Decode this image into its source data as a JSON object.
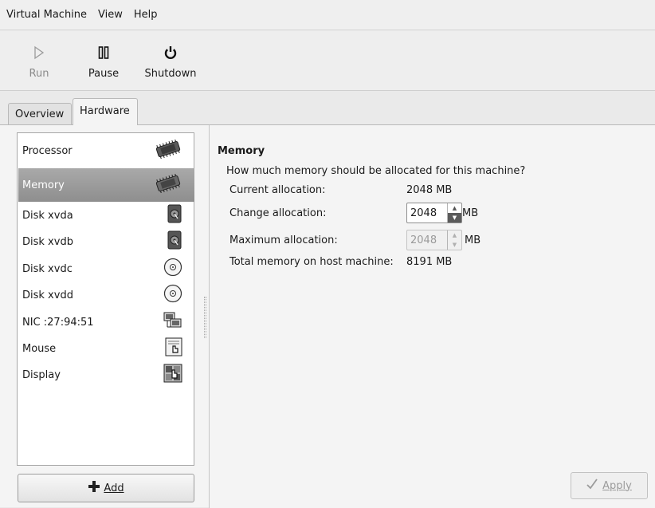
{
  "menubar": {
    "items": [
      {
        "label": "Virtual Machine"
      },
      {
        "label": "View"
      },
      {
        "label": "Help"
      }
    ]
  },
  "toolbar": {
    "run_label": "Run",
    "pause_label": "Pause",
    "shutdown_label": "Shutdown"
  },
  "tabs": {
    "overview": "Overview",
    "hardware": "Hardware"
  },
  "hardware": {
    "items": [
      {
        "label": "Processor",
        "icon": "processor-icon"
      },
      {
        "label": "Memory",
        "icon": "memory-icon",
        "selected": true
      },
      {
        "label": "Disk xvda",
        "icon": "hard-disk-icon"
      },
      {
        "label": "Disk xvdb",
        "icon": "hard-disk-icon"
      },
      {
        "label": "Disk xvdc",
        "icon": "cdrom-icon"
      },
      {
        "label": "Disk xvdd",
        "icon": "cdrom-icon"
      },
      {
        "label": "NIC :27:94:51",
        "icon": "network-icon"
      },
      {
        "label": "Mouse",
        "icon": "mouse-icon"
      },
      {
        "label": "Display",
        "icon": "display-icon"
      }
    ],
    "add_label": "Add"
  },
  "memory": {
    "title": "Memory",
    "question": "How much memory should be allocated for this machine?",
    "current_label": "Current allocation:",
    "current_value": "2048 MB",
    "change_label": "Change allocation:",
    "change_value": "2048",
    "change_unit": "MB",
    "max_label": "Maximum allocation:",
    "max_value": "2048",
    "max_unit": "MB",
    "total_label": "Total memory on host machine:",
    "total_value": "8191 MB"
  },
  "apply_label": "Apply",
  "colors": {
    "selected_row": "#9a9a9a",
    "window_bg": "#f4f4f4"
  }
}
